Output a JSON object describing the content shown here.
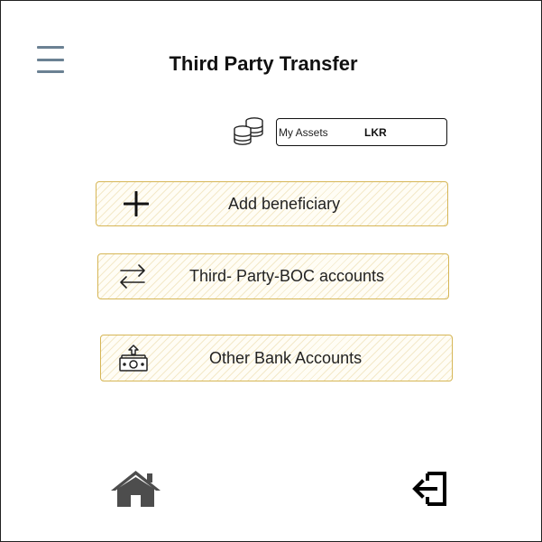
{
  "header": {
    "title": "Third Party Transfer",
    "menu_icon": "hamburger-menu-icon"
  },
  "assets": {
    "icon": "coins-icon",
    "label": "My Assets",
    "currency": "LKR"
  },
  "actions": [
    {
      "label": "Add beneficiary",
      "icon": "plus-icon"
    },
    {
      "label": "Third- Party-BOC accounts",
      "icon": "transfer-arrows-icon"
    },
    {
      "label": "Other Bank Accounts",
      "icon": "cash-upload-icon"
    }
  ],
  "footer": {
    "home_icon": "home-icon",
    "logout_icon": "logout-icon"
  },
  "colors": {
    "button_border": "#d6b656",
    "button_fill": "#fff2cc",
    "menu_icon": "#6b8193",
    "footer_icon": "#4d4d4d"
  }
}
